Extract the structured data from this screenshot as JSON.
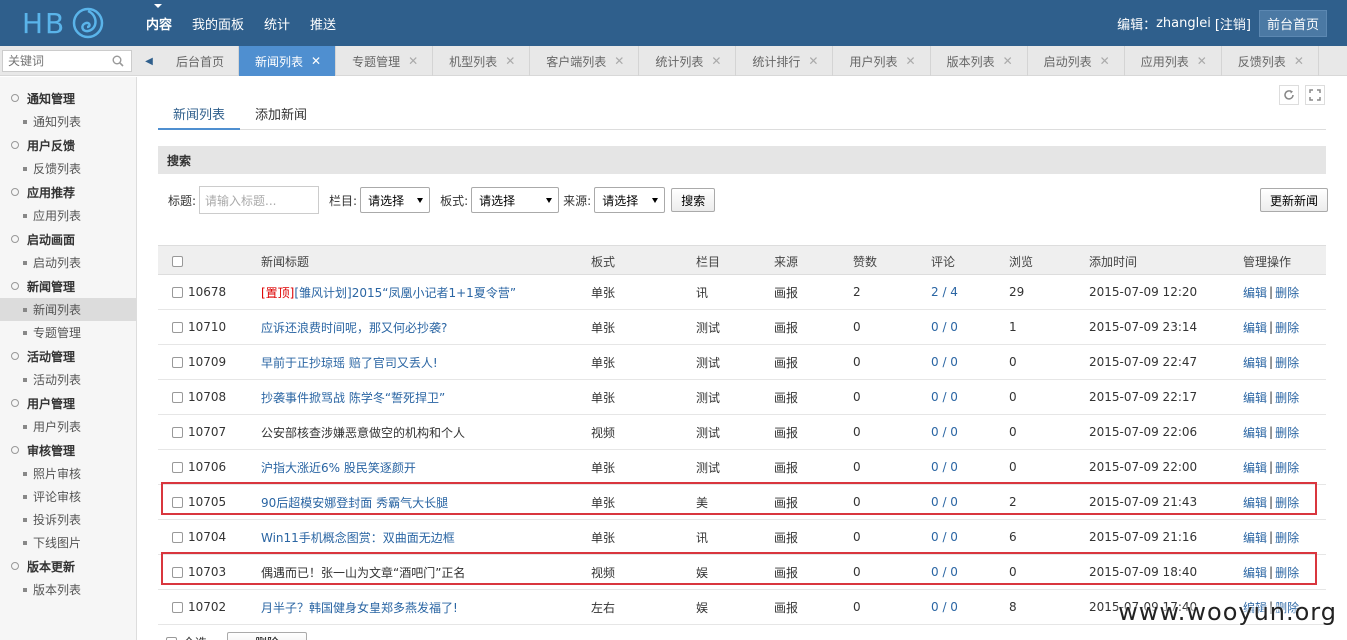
{
  "logo": {
    "text": "HB"
  },
  "topnav": {
    "items": [
      {
        "label": "内容",
        "active": true
      },
      {
        "label": "我的面板",
        "active": false
      },
      {
        "label": "统计",
        "active": false
      },
      {
        "label": "推送",
        "active": false
      }
    ]
  },
  "user": {
    "prefix": "编辑：",
    "name": "zhanglei",
    "logout": "[注销]",
    "frontpage": "前台首页"
  },
  "search": {
    "placeholder": "关键词"
  },
  "tabs": [
    {
      "label": "后台首页",
      "closable": false,
      "active": false
    },
    {
      "label": "新闻列表",
      "closable": true,
      "active": true
    },
    {
      "label": "专题管理",
      "closable": true,
      "active": false
    },
    {
      "label": "机型列表",
      "closable": true,
      "active": false
    },
    {
      "label": "客户端列表",
      "closable": true,
      "active": false
    },
    {
      "label": "统计列表",
      "closable": true,
      "active": false
    },
    {
      "label": "统计排行",
      "closable": true,
      "active": false
    },
    {
      "label": "用户列表",
      "closable": true,
      "active": false
    },
    {
      "label": "版本列表",
      "closable": true,
      "active": false
    },
    {
      "label": "启动列表",
      "closable": true,
      "active": false
    },
    {
      "label": "应用列表",
      "closable": true,
      "active": false
    },
    {
      "label": "反馈列表",
      "closable": true,
      "active": false
    }
  ],
  "sidebar": [
    {
      "group": "通知管理",
      "items": [
        "通知列表"
      ]
    },
    {
      "group": "用户反馈",
      "items": [
        "反馈列表"
      ]
    },
    {
      "group": "应用推荐",
      "items": [
        "应用列表"
      ]
    },
    {
      "group": "启动画面",
      "items": [
        "启动列表"
      ]
    },
    {
      "group": "新闻管理",
      "items": [
        "新闻列表",
        "专题管理"
      ],
      "active_item": "新闻列表"
    },
    {
      "group": "活动管理",
      "items": [
        "活动列表"
      ]
    },
    {
      "group": "用户管理",
      "items": [
        "用户列表"
      ]
    },
    {
      "group": "审核管理",
      "items": [
        "照片审核",
        "评论审核",
        "投诉列表",
        "下线图片"
      ]
    },
    {
      "group": "版本更新",
      "items": [
        "版本列表"
      ]
    }
  ],
  "subtabs": [
    {
      "label": "新闻列表",
      "active": true
    },
    {
      "label": "添加新闻",
      "active": false
    }
  ],
  "searchPanel": {
    "heading": "搜索",
    "title_label": "标题:",
    "title_placeholder": "请输入标题...",
    "column_label": "栏目:",
    "column_value": "请选择",
    "board_label": "板式:",
    "board_value": "请选择",
    "source_label": "来源:",
    "source_value": "请选择",
    "search_button": "搜索",
    "update_button": "更新新闻"
  },
  "table": {
    "headers": {
      "title": "新闻标题",
      "board": "板式",
      "column": "栏目",
      "source": "来源",
      "likes": "赞数",
      "comments": "评论",
      "views": "浏览",
      "time": "添加时间",
      "ops": "管理操作"
    },
    "edit_label": "编辑",
    "delete_label": "删除",
    "separator": "|",
    "rows": [
      {
        "id": "10678",
        "tag": "[置顶]",
        "title": "[雏风计划]2015“凤凰小记者1+1夏令营”",
        "title_style": "link",
        "board": "单张",
        "column": "讯",
        "source": "画报",
        "likes": "2",
        "comments": "2 / 4",
        "views": "29",
        "time": "2015-07-09 12:20",
        "highlight": false
      },
      {
        "id": "10710",
        "tag": "",
        "title": "应诉还浪费时间呢，那又何必抄袭?",
        "title_style": "link",
        "board": "单张",
        "column": "测试",
        "source": "画报",
        "likes": "0",
        "comments": "0 / 0",
        "views": "1",
        "time": "2015-07-09 23:14",
        "highlight": false
      },
      {
        "id": "10709",
        "tag": "",
        "title": "早前于正抄琼瑶 赔了官司又丢人!",
        "title_style": "link",
        "board": "单张",
        "column": "测试",
        "source": "画报",
        "likes": "0",
        "comments": "0 / 0",
        "views": "0",
        "time": "2015-07-09 22:47",
        "highlight": false
      },
      {
        "id": "10708",
        "tag": "",
        "title": "抄袭事件掀骂战 陈学冬“誓死捍卫”",
        "title_style": "link",
        "board": "单张",
        "column": "测试",
        "source": "画报",
        "likes": "0",
        "comments": "0 / 0",
        "views": "0",
        "time": "2015-07-09 22:17",
        "highlight": false
      },
      {
        "id": "10707",
        "tag": "",
        "title": "公安部核查涉嫌恶意做空的机构和个人",
        "title_style": "plain",
        "board": "视频",
        "column": "测试",
        "source": "画报",
        "likes": "0",
        "comments": "0 / 0",
        "views": "0",
        "time": "2015-07-09 22:06",
        "highlight": false
      },
      {
        "id": "10706",
        "tag": "",
        "title": "沪指大涨近6% 股民笑逐颜开",
        "title_style": "link",
        "board": "单张",
        "column": "测试",
        "source": "画报",
        "likes": "0",
        "comments": "0 / 0",
        "views": "0",
        "time": "2015-07-09 22:00",
        "highlight": false
      },
      {
        "id": "10705",
        "tag": "",
        "title": "90后超模安娜登封面 秀霸气大长腿",
        "title_style": "link",
        "board": "单张",
        "column": "美",
        "source": "画报",
        "likes": "0",
        "comments": "0 / 0",
        "views": "2",
        "time": "2015-07-09 21:43",
        "highlight": true
      },
      {
        "id": "10704",
        "tag": "",
        "title": "Win11手机概念图赏：双曲面无边框",
        "title_style": "link",
        "board": "单张",
        "column": "讯",
        "source": "画报",
        "likes": "0",
        "comments": "0 / 0",
        "views": "6",
        "time": "2015-07-09 21:16",
        "highlight": false
      },
      {
        "id": "10703",
        "tag": "",
        "title": "偶遇而已！张一山为文章“酒吧门”正名",
        "title_style": "plain",
        "board": "视频",
        "column": "娱",
        "source": "画报",
        "likes": "0",
        "comments": "0 / 0",
        "views": "0",
        "time": "2015-07-09 18:40",
        "highlight": true
      },
      {
        "id": "10702",
        "tag": "",
        "title": "月半子？韩国健身女皇郑多燕发福了!",
        "title_style": "link",
        "board": "左右",
        "column": "娱",
        "source": "画报",
        "likes": "0",
        "comments": "0 / 0",
        "views": "8",
        "time": "2015-07-09 17:40",
        "highlight": false
      }
    ]
  },
  "footer": {
    "select_all": "全选",
    "batch_button": "删除"
  },
  "watermark": "www.wooyun.org",
  "colors": {
    "topbar": "#2f5f8c",
    "active_tab": "#4f8fd0",
    "link": "#2a65a3",
    "highlight": "#d9363e"
  }
}
